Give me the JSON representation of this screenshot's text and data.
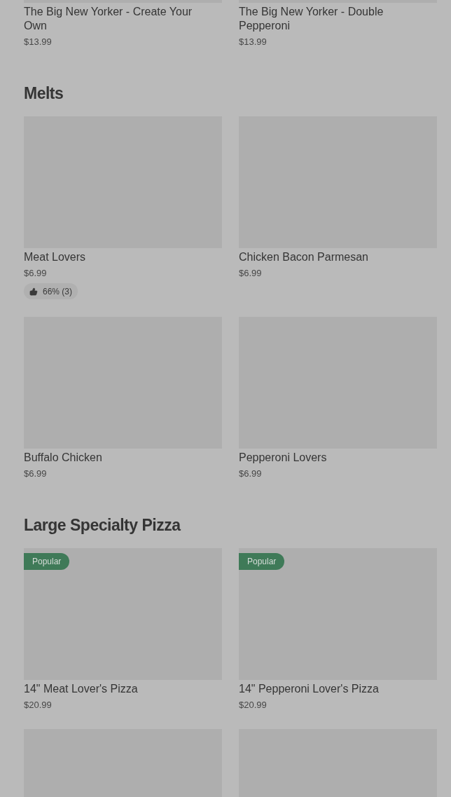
{
  "sections": [
    {
      "items": [
        {
          "kind": "card",
          "name": "The Big New Yorker - Create Your Own",
          "price": "$13.99"
        },
        {
          "kind": "card",
          "name": "The Big New Yorker - Double Pepperoni",
          "price": "$13.99"
        }
      ]
    },
    {
      "title": "Melts",
      "items": [
        {
          "kind": "card",
          "name": "Meat Lovers",
          "price": "$6.99",
          "rating": "66% (3)"
        },
        {
          "kind": "card",
          "name": "Chicken Bacon Parmesan",
          "price": "$6.99"
        },
        {
          "kind": "card",
          "name": "Buffalo Chicken",
          "price": "$6.99"
        },
        {
          "kind": "card",
          "name": "Pepperoni Lovers",
          "price": "$6.99"
        }
      ]
    },
    {
      "title": "Large Specialty Pizza",
      "items": [
        {
          "kind": "card",
          "name": "14\" Meat Lover's Pizza",
          "price": "$20.99",
          "tag": "Popular"
        },
        {
          "kind": "card",
          "name": "14\" Pepperoni Lover's Pizza",
          "price": "$20.99",
          "tag": "Popular"
        },
        {
          "kind": "image_only"
        },
        {
          "kind": "image_only"
        }
      ]
    }
  ]
}
